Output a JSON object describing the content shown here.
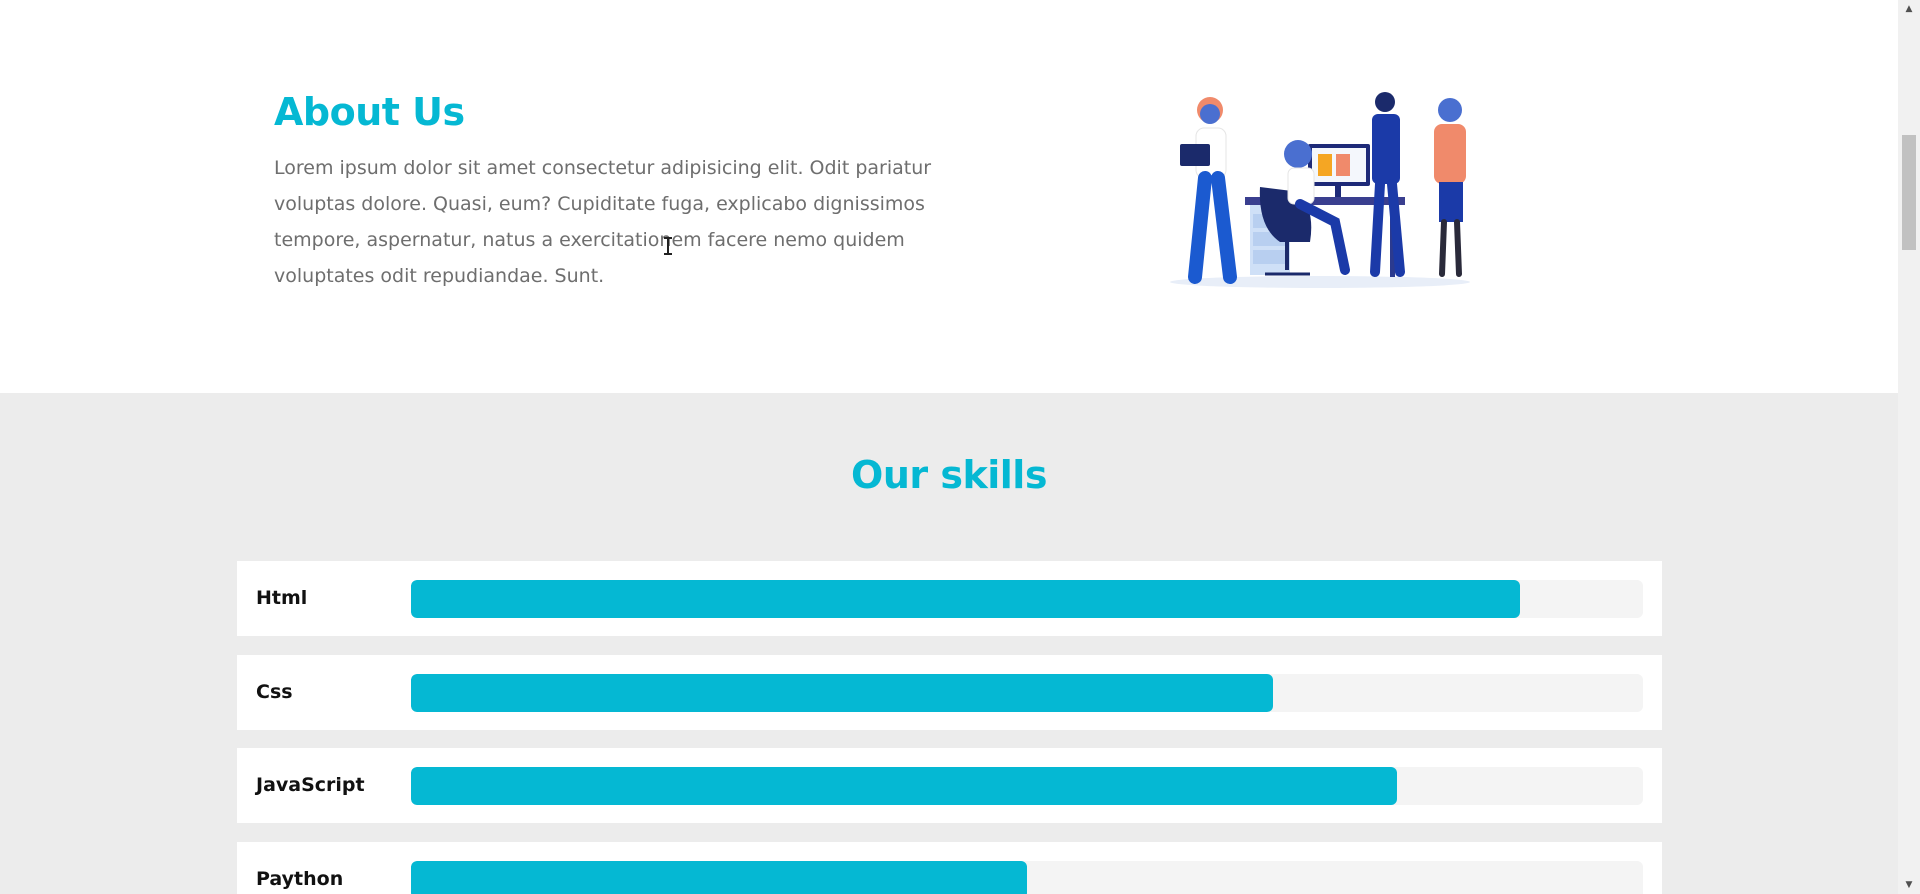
{
  "about": {
    "title": "About Us",
    "text": "Lorem ipsum dolor sit amet consectetur adipisicing elit. Odit pariatur voluptas dolore. Quasi, eum? Cupiditate fuga, explicabo dignissimos tempore, aspernatur, natus a exercitationem facere nemo quidem voluptates odit repudiandae. Sunt."
  },
  "skills": {
    "title": "Our skills",
    "items": [
      {
        "label": "Html",
        "percent": 90
      },
      {
        "label": "Css",
        "percent": 70
      },
      {
        "label": "JavaScript",
        "percent": 80
      },
      {
        "label": "Paython",
        "percent": 50
      }
    ]
  },
  "colors": {
    "accent": "#05b8d3",
    "section_bg": "#ececec",
    "track": "#f4f4f4"
  },
  "icons": {
    "illustration": "team-office-illustration",
    "cursor": "text-cursor-icon",
    "scroll_up": "chevron-up-icon",
    "scroll_down": "chevron-down-icon"
  }
}
